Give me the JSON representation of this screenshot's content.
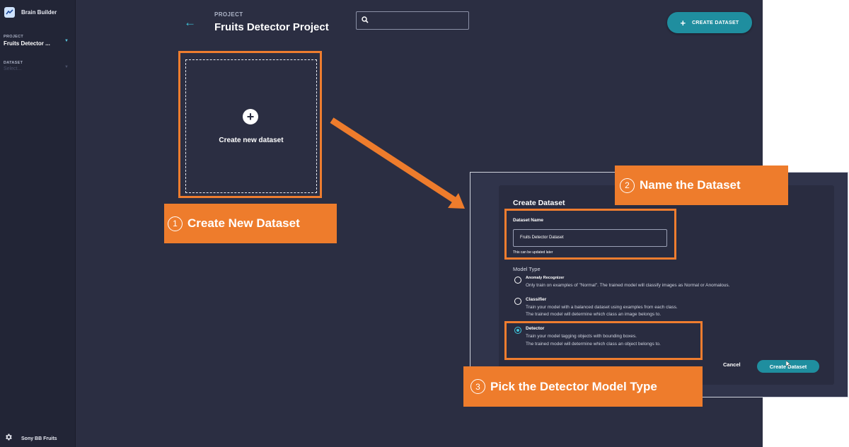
{
  "app": {
    "name": "Brain Builder",
    "logo_icon": "chart-line-icon"
  },
  "sidebar": {
    "project_label": "PROJECT",
    "project_value": "Fruits Detector ...",
    "dataset_label": "DATASET",
    "dataset_placeholder": "Select...",
    "account_name": "Sony BB Fruits",
    "account_icon": "gear-icon"
  },
  "header": {
    "back_icon": "arrow-left-icon",
    "project_label": "PROJECT",
    "project_title": "Fruits Detector Project",
    "search_icon": "search-icon",
    "search_placeholder": "",
    "create_button": "CREATE DATASET"
  },
  "new_dataset_card": {
    "icon": "plus-circle-icon",
    "label": "Create new dataset"
  },
  "callouts": [
    {
      "num": "1",
      "text": "Create New Dataset"
    },
    {
      "num": "2",
      "text": "Name the Dataset"
    },
    {
      "num": "3",
      "text": "Pick the Detector Model Type"
    }
  ],
  "dialog": {
    "title": "Create Dataset",
    "dataset_name_label": "Dataset Name",
    "dataset_name_value": "Fruits Detector Dataset",
    "dataset_name_hint": "This can be updated later",
    "model_type_label": "Model Type",
    "options": [
      {
        "title": "Anomaly Recognizer",
        "desc1": "Only train on examples of \"Normal\". The trained model will classify images as Normal or Anomalous.",
        "desc2": "",
        "selected": false
      },
      {
        "title": "Classifier",
        "desc1": "Train your model with a balanced dataset using examples from each class.",
        "desc2": "The trained model will determine which class an image belongs to.",
        "selected": false
      },
      {
        "title": "Detector",
        "desc1": "Train your model tagging objects with bounding boxes.",
        "desc2": "The trained model will determine which class an object belongs to.",
        "selected": true
      }
    ],
    "cancel_label": "Cancel",
    "submit_label": "Create Dataset"
  },
  "colors": {
    "app_bg": "#2b2e42",
    "sidebar_bg": "#222536",
    "accent_teal": "#1f8e9f",
    "callout_orange": "#ee7c2c"
  }
}
